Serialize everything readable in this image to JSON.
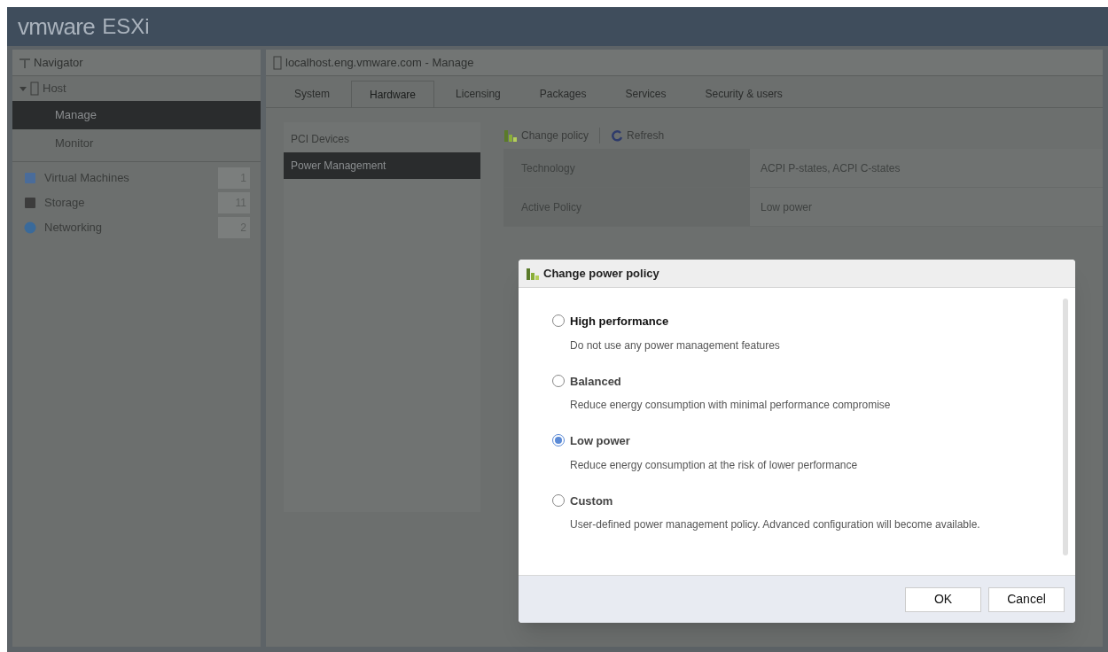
{
  "header": {
    "brand": "vmware",
    "product": "ESXi"
  },
  "navigator": {
    "title": "Navigator",
    "host": {
      "label": "Host",
      "expanded": true,
      "children": [
        {
          "label": "Manage",
          "selected": true
        },
        {
          "label": "Monitor",
          "selected": false
        }
      ]
    },
    "items": [
      {
        "label": "Virtual Machines",
        "count": "1",
        "kind": "vm"
      },
      {
        "label": "Storage",
        "count": "11",
        "kind": "storage"
      },
      {
        "label": "Networking",
        "count": "2",
        "kind": "network"
      }
    ]
  },
  "main": {
    "title": "localhost.eng.vmware.com - Manage",
    "tabs": [
      {
        "label": "System",
        "selected": false
      },
      {
        "label": "Hardware",
        "selected": true
      },
      {
        "label": "Licensing",
        "selected": false
      },
      {
        "label": "Packages",
        "selected": false
      },
      {
        "label": "Services",
        "selected": false
      },
      {
        "label": "Security & users",
        "selected": false
      }
    ],
    "side_items": [
      {
        "label": "PCI Devices",
        "selected": false
      },
      {
        "label": "Power Management",
        "selected": true
      }
    ],
    "toolbar": [
      {
        "label": "Change policy",
        "kind": "policy"
      },
      {
        "label": "Refresh",
        "kind": "refresh"
      }
    ],
    "properties": [
      {
        "name": "Technology",
        "value": "ACPI P-states, ACPI C-states"
      },
      {
        "name": "Active Policy",
        "value": "Low power"
      }
    ]
  },
  "dialog": {
    "title": "Change power policy",
    "options": [
      {
        "label": "High performance",
        "description": "Do not use any power management features",
        "selected": false
      },
      {
        "label": "Balanced",
        "description": "Reduce energy consumption with minimal performance compromise",
        "selected": false
      },
      {
        "label": "Low power",
        "description": "Reduce energy consumption at the risk of lower performance",
        "selected": true
      },
      {
        "label": "Custom",
        "description": "User-defined power management policy. Advanced configuration will become available.",
        "selected": false
      }
    ],
    "buttons": [
      "OK",
      "Cancel"
    ]
  }
}
